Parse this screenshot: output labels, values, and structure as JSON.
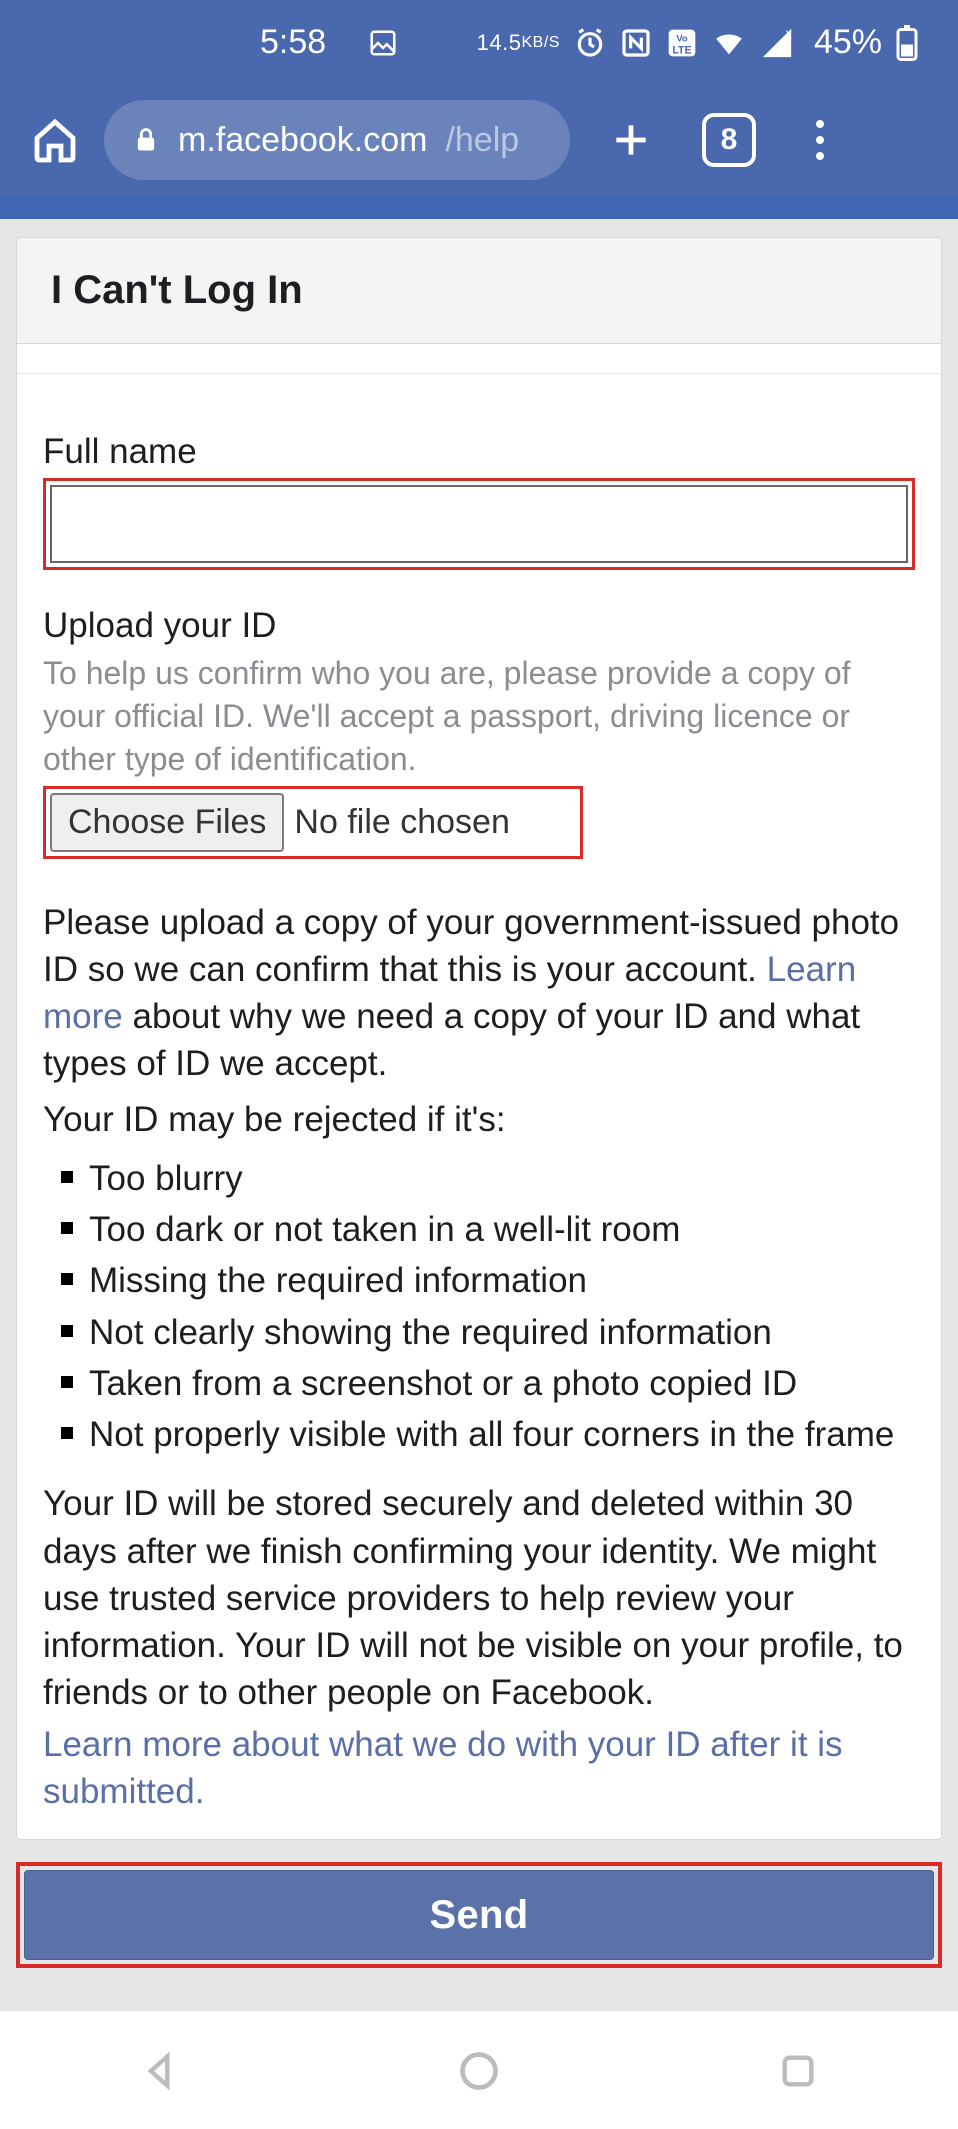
{
  "status": {
    "time": "5:58",
    "net_rate_num": "14.5",
    "net_rate_unit": "KB/S",
    "battery_pct": "45%"
  },
  "browser": {
    "url_host": "m.facebook.com",
    "url_path": "/help",
    "tab_count": "8"
  },
  "header": {
    "title": "I Can't Log In"
  },
  "form": {
    "fullname_label": "Full name",
    "fullname_value": "",
    "upload_label": "Upload your ID",
    "upload_desc": "To help us confirm who you are, please provide a copy of your official ID. We'll accept a passport, driving licence or other type of identification.",
    "choose_files_label": "Choose Files",
    "file_status": "No file chosen",
    "para_pre": "Please upload a copy of your government-issued photo ID so we can confirm that this is your account. ",
    "learn_more": "Learn more",
    "para_post": " about why we need a copy of your ID and what types of ID we accept.",
    "reject_intro": "Your ID may be rejected if it's:",
    "reject_items": [
      "Too blurry",
      "Too dark or not taken in a well-lit room",
      "Missing the required information",
      "Not clearly showing the required information",
      "Taken from a screenshot or a photo copied ID",
      "Not properly visible with all four corners in the frame"
    ],
    "storage_para": "Your ID will be stored securely and deleted within 30 days after we finish confirming your identity. We might use trusted service providers to help review your information. Your ID will not be visible on your profile, to friends or to other people on Facebook.",
    "learn_more_2": "Learn more about what we do with your ID after it is submitted.",
    "send_label": "Send"
  }
}
